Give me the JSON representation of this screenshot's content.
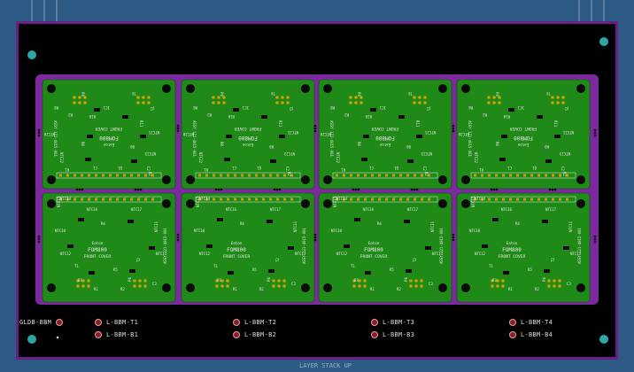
{
  "panel": {
    "board_count": 8,
    "rows": 2,
    "cols": 4,
    "colors": {
      "background": "#2e5a86",
      "sheet": "#000000",
      "sheet_border": "#6a1e86",
      "board": "#1f8a18",
      "board_dark": "#176e12",
      "cut": "#7a2a9c",
      "silk": "#e8e8e8",
      "pad": "#c9a100",
      "hole": "#0a0a0a",
      "fiducial": "#2aa8a8"
    }
  },
  "top_board": {
    "title": "FRONT COVER",
    "part": "FOM800",
    "brand": "Eaton",
    "part_no": "ASSY 121-4015-001",
    "labels": [
      "P4",
      "T4",
      "R6",
      "T5",
      "R3",
      "R10",
      "R11",
      "C1",
      "Q1",
      "C2",
      "NTC20",
      "NTC21",
      "NTC22",
      "NTC23",
      "IC1",
      "R8",
      "R9",
      "R1",
      "R2"
    ]
  },
  "bottom_board": {
    "title": "FRONT COVER",
    "part": "FOM800",
    "brand": "Eaton",
    "part_no": "ASSY 121-4015-001",
    "labels": [
      "NTC14",
      "NTC15",
      "NTC16",
      "NTC17",
      "NTC10",
      "NTC11",
      "NTC12",
      "NTC13",
      "P3",
      "P4",
      "R4",
      "R5",
      "T1",
      "T2",
      "R1",
      "R2",
      "C3"
    ]
  },
  "legend": {
    "main": "GLDB-BBM",
    "items": [
      {
        "top": "L-BBM-T1",
        "bottom": "L-BBM-B1"
      },
      {
        "top": "L-BBM-T2",
        "bottom": "L-BBM-B2"
      },
      {
        "top": "L-BBM-T3",
        "bottom": "L-BBM-B3"
      },
      {
        "top": "L-BBM-T4",
        "bottom": "L-BBM-B4"
      }
    ]
  },
  "footer": "LAYER STACK UP"
}
